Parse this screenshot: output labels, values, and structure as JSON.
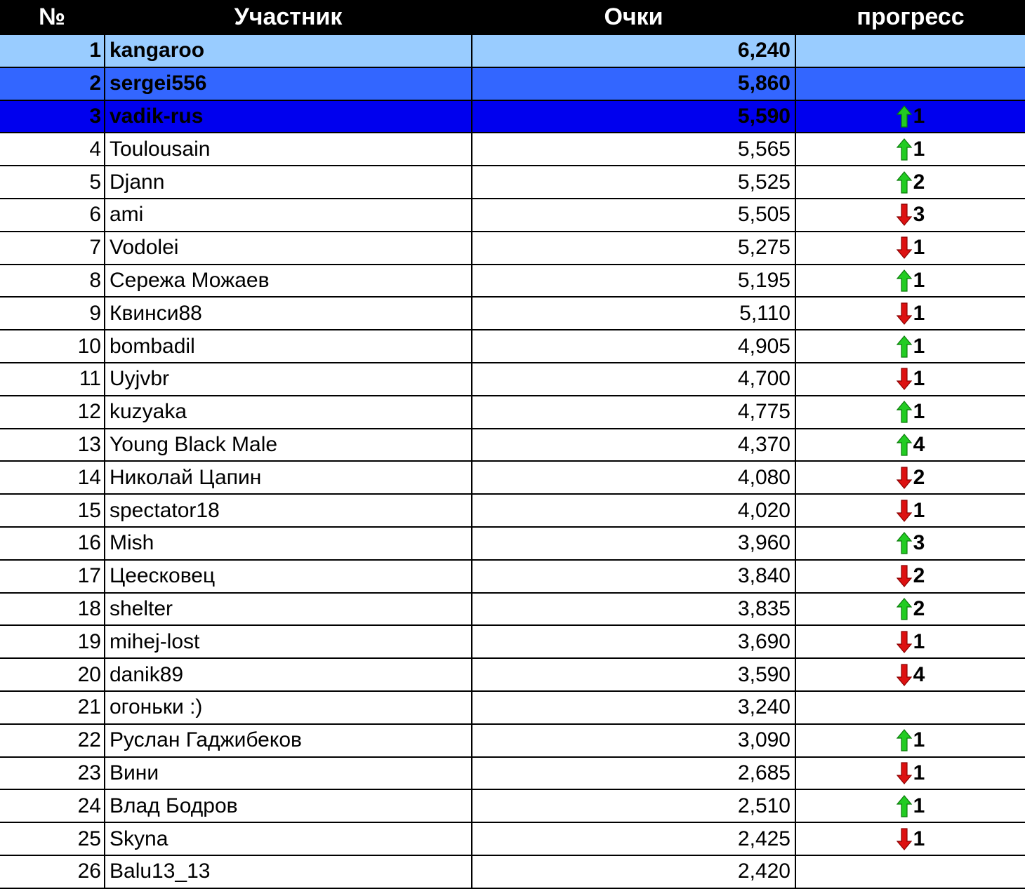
{
  "header": {
    "col_rank": "№",
    "col_name": "Участник",
    "col_score": "Очки",
    "col_progress": "прогресс"
  },
  "colors": {
    "header_bg": "#000000",
    "row1_bg": "#99ccff",
    "row2_bg": "#3366ff",
    "row3_bg": "#0000ee",
    "arrow_up": "#22cc22",
    "arrow_down": "#dd1111"
  },
  "rows": [
    {
      "rank": "1",
      "name": "kangaroo",
      "score": "6,240",
      "dir": "",
      "delta": ""
    },
    {
      "rank": "2",
      "name": "sergei556",
      "score": "5,860",
      "dir": "",
      "delta": ""
    },
    {
      "rank": "3",
      "name": "vadik-rus",
      "score": "5,590",
      "dir": "up",
      "delta": "1"
    },
    {
      "rank": "4",
      "name": "Toulousain",
      "score": "5,565",
      "dir": "up",
      "delta": "1"
    },
    {
      "rank": "5",
      "name": "Djann",
      "score": "5,525",
      "dir": "up",
      "delta": "2"
    },
    {
      "rank": "6",
      "name": "ami",
      "score": "5,505",
      "dir": "down",
      "delta": "3"
    },
    {
      "rank": "7",
      "name": "Vodolei",
      "score": "5,275",
      "dir": "down",
      "delta": "1"
    },
    {
      "rank": "8",
      "name": "Сережа Можаев",
      "score": "5,195",
      "dir": "up",
      "delta": "1"
    },
    {
      "rank": "9",
      "name": "Квинси88",
      "score": "5,110",
      "dir": "down",
      "delta": "1"
    },
    {
      "rank": "10",
      "name": "bombadil",
      "score": "4,905",
      "dir": "up",
      "delta": "1"
    },
    {
      "rank": "11",
      "name": "Uyjvbr",
      "score": "4,700",
      "dir": "down",
      "delta": "1"
    },
    {
      "rank": "12",
      "name": "kuzyaka",
      "score": "4,775",
      "dir": "up",
      "delta": "1"
    },
    {
      "rank": "13",
      "name": "Young Black Male",
      "score": "4,370",
      "dir": "up",
      "delta": "4"
    },
    {
      "rank": "14",
      "name": "Николай Цапин",
      "score": "4,080",
      "dir": "down",
      "delta": "2"
    },
    {
      "rank": "15",
      "name": "spectator18",
      "score": "4,020",
      "dir": "down",
      "delta": "1"
    },
    {
      "rank": "16",
      "name": "Mish",
      "score": "3,960",
      "dir": "up",
      "delta": "3"
    },
    {
      "rank": "17",
      "name": "Цеесковец",
      "score": "3,840",
      "dir": "down",
      "delta": "2"
    },
    {
      "rank": "18",
      "name": "shelter",
      "score": "3,835",
      "dir": "up",
      "delta": "2"
    },
    {
      "rank": "19",
      "name": "mihej-lost",
      "score": "3,690",
      "dir": "down",
      "delta": "1"
    },
    {
      "rank": "20",
      "name": "danik89",
      "score": "3,590",
      "dir": "down",
      "delta": "4"
    },
    {
      "rank": "21",
      "name": "огоньки :)",
      "score": "3,240",
      "dir": "",
      "delta": ""
    },
    {
      "rank": "22",
      "name": "Руслан Гаджибеков",
      "score": "3,090",
      "dir": "up",
      "delta": "1"
    },
    {
      "rank": "23",
      "name": "Вини",
      "score": "2,685",
      "dir": "down",
      "delta": "1"
    },
    {
      "rank": "24",
      "name": "Влад Бодров",
      "score": "2,510",
      "dir": "up",
      "delta": "1"
    },
    {
      "rank": "25",
      "name": "Skyna",
      "score": "2,425",
      "dir": "down",
      "delta": "1"
    },
    {
      "rank": "26",
      "name": "Balu13_13",
      "score": "2,420",
      "dir": "",
      "delta": ""
    }
  ]
}
